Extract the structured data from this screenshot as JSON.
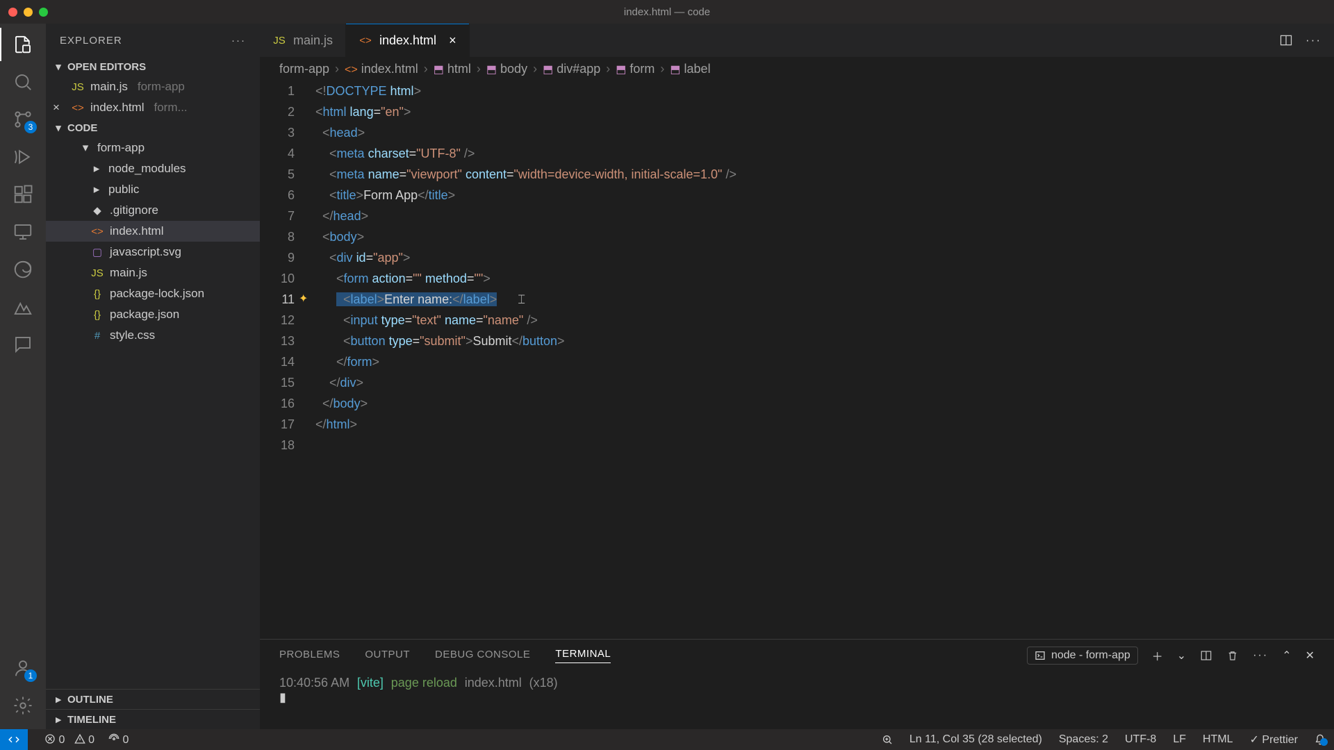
{
  "titlebar": {
    "title": "index.html — code"
  },
  "activity": {
    "scm_badge": "3",
    "account_badge": "1"
  },
  "sidebar": {
    "title": "EXPLORER",
    "open_editors_label": "OPEN EDITORS",
    "open_editors": [
      {
        "icon": "JS",
        "name": "main.js",
        "path": "form-app"
      },
      {
        "icon": "<>",
        "name": "index.html",
        "path": "form...",
        "close": true
      }
    ],
    "workspace_label": "CODE",
    "folder": "form-app",
    "files": [
      {
        "type": "folder",
        "name": "node_modules"
      },
      {
        "type": "folder",
        "name": "public"
      },
      {
        "type": "file",
        "icon": "git",
        "name": ".gitignore"
      },
      {
        "type": "file",
        "icon": "html",
        "name": "index.html",
        "selected": true
      },
      {
        "type": "file",
        "icon": "svg",
        "name": "javascript.svg"
      },
      {
        "type": "file",
        "icon": "js",
        "name": "main.js"
      },
      {
        "type": "file",
        "icon": "json",
        "name": "package-lock.json"
      },
      {
        "type": "file",
        "icon": "json",
        "name": "package.json"
      },
      {
        "type": "file",
        "icon": "css",
        "name": "style.css"
      }
    ],
    "outline_label": "OUTLINE",
    "timeline_label": "TIMELINE"
  },
  "tabs": [
    {
      "icon": "JS",
      "label": "main.js"
    },
    {
      "icon": "<>",
      "label": "index.html",
      "active": true,
      "close": true
    }
  ],
  "breadcrumb": [
    "form-app",
    "index.html",
    "html",
    "body",
    "div#app",
    "form",
    "label"
  ],
  "code": {
    "lines": [
      [
        {
          "c": "t-gray",
          "t": "<!"
        },
        {
          "c": "t-blue",
          "t": "DOCTYPE"
        },
        {
          "c": "t-white",
          "t": " "
        },
        {
          "c": "t-lblue",
          "t": "html"
        },
        {
          "c": "t-gray",
          "t": ">"
        }
      ],
      [
        {
          "c": "t-gray",
          "t": "<"
        },
        {
          "c": "t-blue",
          "t": "html"
        },
        {
          "c": "t-white",
          "t": " "
        },
        {
          "c": "t-lblue",
          "t": "lang"
        },
        {
          "c": "t-white",
          "t": "="
        },
        {
          "c": "t-orange",
          "t": "\"en\""
        },
        {
          "c": "t-gray",
          "t": ">"
        }
      ],
      [
        {
          "c": "t-white",
          "t": "  "
        },
        {
          "c": "t-gray",
          "t": "<"
        },
        {
          "c": "t-blue",
          "t": "head"
        },
        {
          "c": "t-gray",
          "t": ">"
        }
      ],
      [
        {
          "c": "t-white",
          "t": "    "
        },
        {
          "c": "t-gray",
          "t": "<"
        },
        {
          "c": "t-blue",
          "t": "meta"
        },
        {
          "c": "t-white",
          "t": " "
        },
        {
          "c": "t-lblue",
          "t": "charset"
        },
        {
          "c": "t-white",
          "t": "="
        },
        {
          "c": "t-orange",
          "t": "\"UTF-8\""
        },
        {
          "c": "t-white",
          "t": " "
        },
        {
          "c": "t-gray",
          "t": "/>"
        }
      ],
      [
        {
          "c": "t-white",
          "t": "    "
        },
        {
          "c": "t-gray",
          "t": "<"
        },
        {
          "c": "t-blue",
          "t": "meta"
        },
        {
          "c": "t-white",
          "t": " "
        },
        {
          "c": "t-lblue",
          "t": "name"
        },
        {
          "c": "t-white",
          "t": "="
        },
        {
          "c": "t-orange",
          "t": "\"viewport\""
        },
        {
          "c": "t-white",
          "t": " "
        },
        {
          "c": "t-lblue",
          "t": "content"
        },
        {
          "c": "t-white",
          "t": "="
        },
        {
          "c": "t-orange",
          "t": "\"width=device-width, initial-scale=1.0\""
        },
        {
          "c": "t-white",
          "t": " "
        },
        {
          "c": "t-gray",
          "t": "/>"
        }
      ],
      [
        {
          "c": "t-white",
          "t": "    "
        },
        {
          "c": "t-gray",
          "t": "<"
        },
        {
          "c": "t-blue",
          "t": "title"
        },
        {
          "c": "t-gray",
          "t": ">"
        },
        {
          "c": "t-white",
          "t": "Form App"
        },
        {
          "c": "t-gray",
          "t": "</"
        },
        {
          "c": "t-blue",
          "t": "title"
        },
        {
          "c": "t-gray",
          "t": ">"
        }
      ],
      [
        {
          "c": "t-white",
          "t": "  "
        },
        {
          "c": "t-gray",
          "t": "</"
        },
        {
          "c": "t-blue",
          "t": "head"
        },
        {
          "c": "t-gray",
          "t": ">"
        }
      ],
      [
        {
          "c": "t-white",
          "t": "  "
        },
        {
          "c": "t-gray",
          "t": "<"
        },
        {
          "c": "t-blue",
          "t": "body"
        },
        {
          "c": "t-gray",
          "t": ">"
        }
      ],
      [
        {
          "c": "t-white",
          "t": "    "
        },
        {
          "c": "t-gray",
          "t": "<"
        },
        {
          "c": "t-blue",
          "t": "div"
        },
        {
          "c": "t-white",
          "t": " "
        },
        {
          "c": "t-lblue",
          "t": "id"
        },
        {
          "c": "t-white",
          "t": "="
        },
        {
          "c": "t-orange",
          "t": "\"app\""
        },
        {
          "c": "t-gray",
          "t": ">"
        }
      ],
      [
        {
          "c": "t-white",
          "t": "      "
        },
        {
          "c": "t-gray",
          "t": "<"
        },
        {
          "c": "t-blue",
          "t": "form"
        },
        {
          "c": "t-white",
          "t": " "
        },
        {
          "c": "t-lblue",
          "t": "action"
        },
        {
          "c": "t-white",
          "t": "="
        },
        {
          "c": "t-orange",
          "t": "\"\""
        },
        {
          "c": "t-white",
          "t": " "
        },
        {
          "c": "t-lblue",
          "t": "method"
        },
        {
          "c": "t-white",
          "t": "="
        },
        {
          "c": "t-orange",
          "t": "\"\""
        },
        {
          "c": "t-gray",
          "t": ">"
        }
      ],
      [
        {
          "c": "t-white",
          "t": "      "
        },
        {
          "sel": true,
          "parts": [
            {
              "c": "t-white",
              "t": "  "
            },
            {
              "c": "t-gray",
              "t": "<"
            },
            {
              "c": "t-blue",
              "t": "label"
            },
            {
              "c": "t-gray",
              "t": ">"
            },
            {
              "c": "t-white",
              "t": "Enter name:"
            },
            {
              "c": "t-gray",
              "t": "</"
            },
            {
              "c": "t-blue",
              "t": "label"
            },
            {
              "c": "t-gray",
              "t": ">"
            }
          ]
        },
        {
          "spark": true
        }
      ],
      [
        {
          "c": "t-white",
          "t": "        "
        },
        {
          "c": "t-gray",
          "t": "<"
        },
        {
          "c": "t-blue",
          "t": "input"
        },
        {
          "c": "t-white",
          "t": " "
        },
        {
          "c": "t-lblue",
          "t": "type"
        },
        {
          "c": "t-white",
          "t": "="
        },
        {
          "c": "t-orange",
          "t": "\"text\""
        },
        {
          "c": "t-white",
          "t": " "
        },
        {
          "c": "t-lblue",
          "t": "name"
        },
        {
          "c": "t-white",
          "t": "="
        },
        {
          "c": "t-orange",
          "t": "\"name\""
        },
        {
          "c": "t-white",
          "t": " "
        },
        {
          "c": "t-gray",
          "t": "/>"
        }
      ],
      [
        {
          "c": "t-white",
          "t": "        "
        },
        {
          "c": "t-gray",
          "t": "<"
        },
        {
          "c": "t-blue",
          "t": "button"
        },
        {
          "c": "t-white",
          "t": " "
        },
        {
          "c": "t-lblue",
          "t": "type"
        },
        {
          "c": "t-white",
          "t": "="
        },
        {
          "c": "t-orange",
          "t": "\"submit\""
        },
        {
          "c": "t-gray",
          "t": ">"
        },
        {
          "c": "t-white",
          "t": "Submit"
        },
        {
          "c": "t-gray",
          "t": "</"
        },
        {
          "c": "t-blue",
          "t": "button"
        },
        {
          "c": "t-gray",
          "t": ">"
        }
      ],
      [
        {
          "c": "t-white",
          "t": "      "
        },
        {
          "c": "t-gray",
          "t": "</"
        },
        {
          "c": "t-blue",
          "t": "form"
        },
        {
          "c": "t-gray",
          "t": ">"
        }
      ],
      [
        {
          "c": "t-white",
          "t": "    "
        },
        {
          "c": "t-gray",
          "t": "</"
        },
        {
          "c": "t-blue",
          "t": "div"
        },
        {
          "c": "t-gray",
          "t": ">"
        }
      ],
      [
        {
          "c": "t-white",
          "t": "  "
        },
        {
          "c": "t-gray",
          "t": "</"
        },
        {
          "c": "t-blue",
          "t": "body"
        },
        {
          "c": "t-gray",
          "t": ">"
        }
      ],
      [
        {
          "c": "t-gray",
          "t": "</"
        },
        {
          "c": "t-blue",
          "t": "html"
        },
        {
          "c": "t-gray",
          "t": ">"
        }
      ],
      []
    ],
    "current_line": 11
  },
  "panel": {
    "tabs": [
      "PROBLEMS",
      "OUTPUT",
      "DEBUG CONSOLE",
      "TERMINAL"
    ],
    "active_tab": "TERMINAL",
    "terminal_process": "node - form-app",
    "terminal_line": {
      "time": "10:40:56 AM",
      "tag": "[vite]",
      "action": "page reload",
      "file": "index.html",
      "count": "(x18)"
    }
  },
  "statusbar": {
    "errors": "0",
    "warnings": "0",
    "ports": "0",
    "cursor": "Ln 11, Col 35 (28 selected)",
    "spaces": "Spaces: 2",
    "encoding": "UTF-8",
    "eol": "LF",
    "lang": "HTML",
    "prettier": "Prettier"
  }
}
